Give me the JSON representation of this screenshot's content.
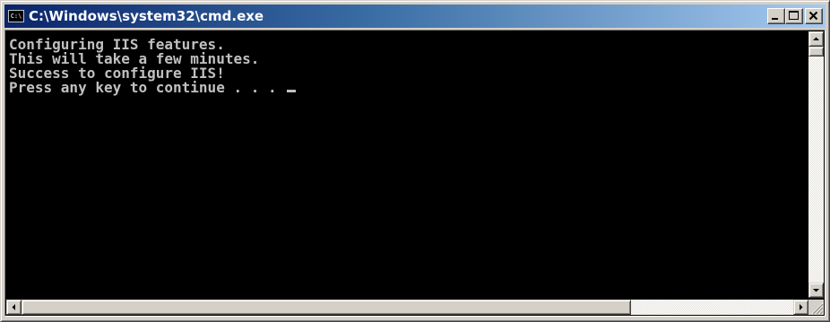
{
  "window": {
    "title": "C:\\Windows\\system32\\cmd.exe",
    "icon_name": "cmd-icon",
    "icon_text": "C:\\"
  },
  "caption_buttons": [
    {
      "name": "minimize-icon"
    },
    {
      "name": "maximize-icon"
    },
    {
      "name": "close-icon"
    }
  ],
  "console": {
    "lines": [
      "Configuring IIS features.",
      "This will take a few minutes.",
      "Success to configure IIS!",
      "Press any key to continue . . . "
    ],
    "text_color": "#c0c0c0",
    "background_color": "#000000"
  },
  "colors": {
    "title_gradient_start": "#0a246a",
    "title_gradient_end": "#a6caf0",
    "chrome": "#d4d0c8"
  }
}
